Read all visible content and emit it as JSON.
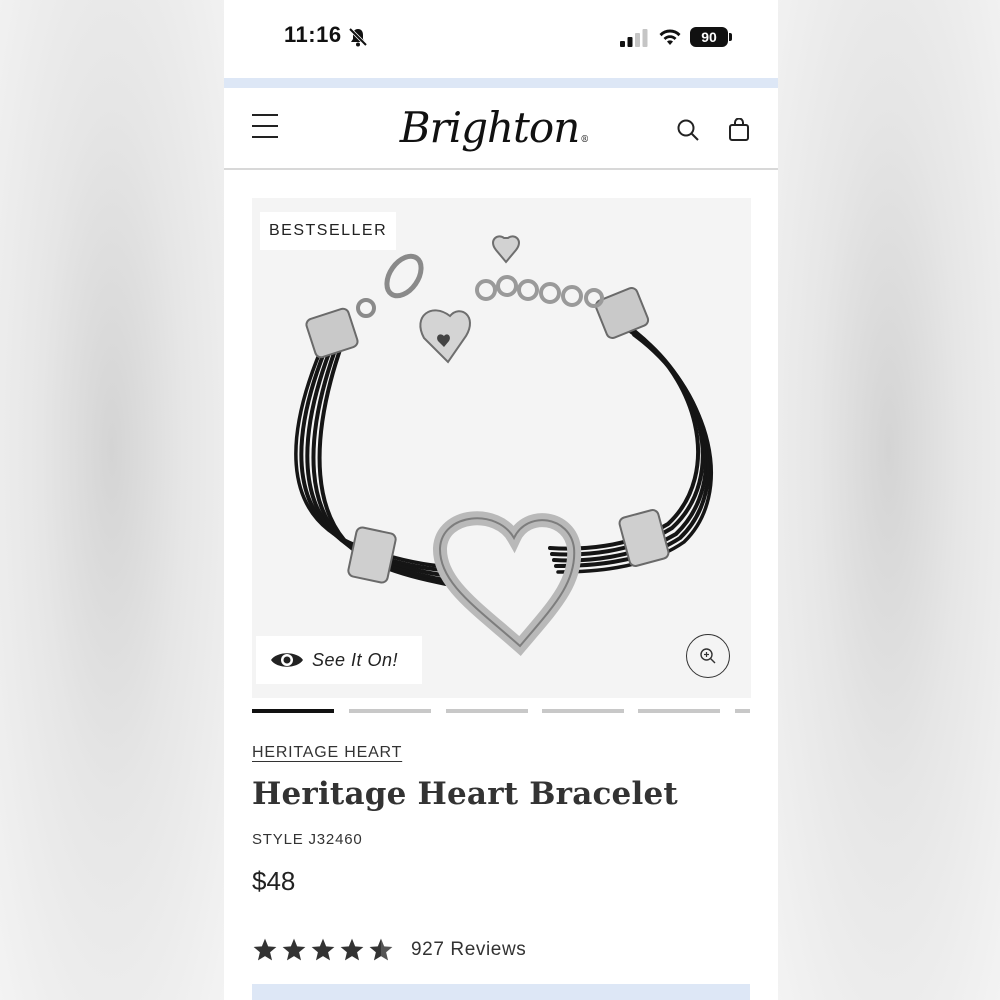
{
  "status_bar": {
    "time": "11:16",
    "battery": "90",
    "icons": [
      "bell-slash-icon",
      "signal-icon",
      "wifi-icon",
      "battery-icon"
    ]
  },
  "header": {
    "logo": "Brighton",
    "logo_mark": "®",
    "icons": [
      "hamburger-menu-icon",
      "search-icon",
      "shopping-bag-icon"
    ]
  },
  "product": {
    "badge": "BESTSELLER",
    "see_it_on": "See It On!",
    "image_count": 6,
    "active_image": 1,
    "collection": "HERITAGE HEART",
    "name": "Heritage Heart Bracelet",
    "style": "STYLE J32460",
    "price": "$48",
    "rating": 4.5,
    "reviews": "927 Reviews"
  },
  "colors": {
    "accent_blue": "#dde7f6",
    "text": "#333333",
    "active_indicator": "#111111"
  }
}
